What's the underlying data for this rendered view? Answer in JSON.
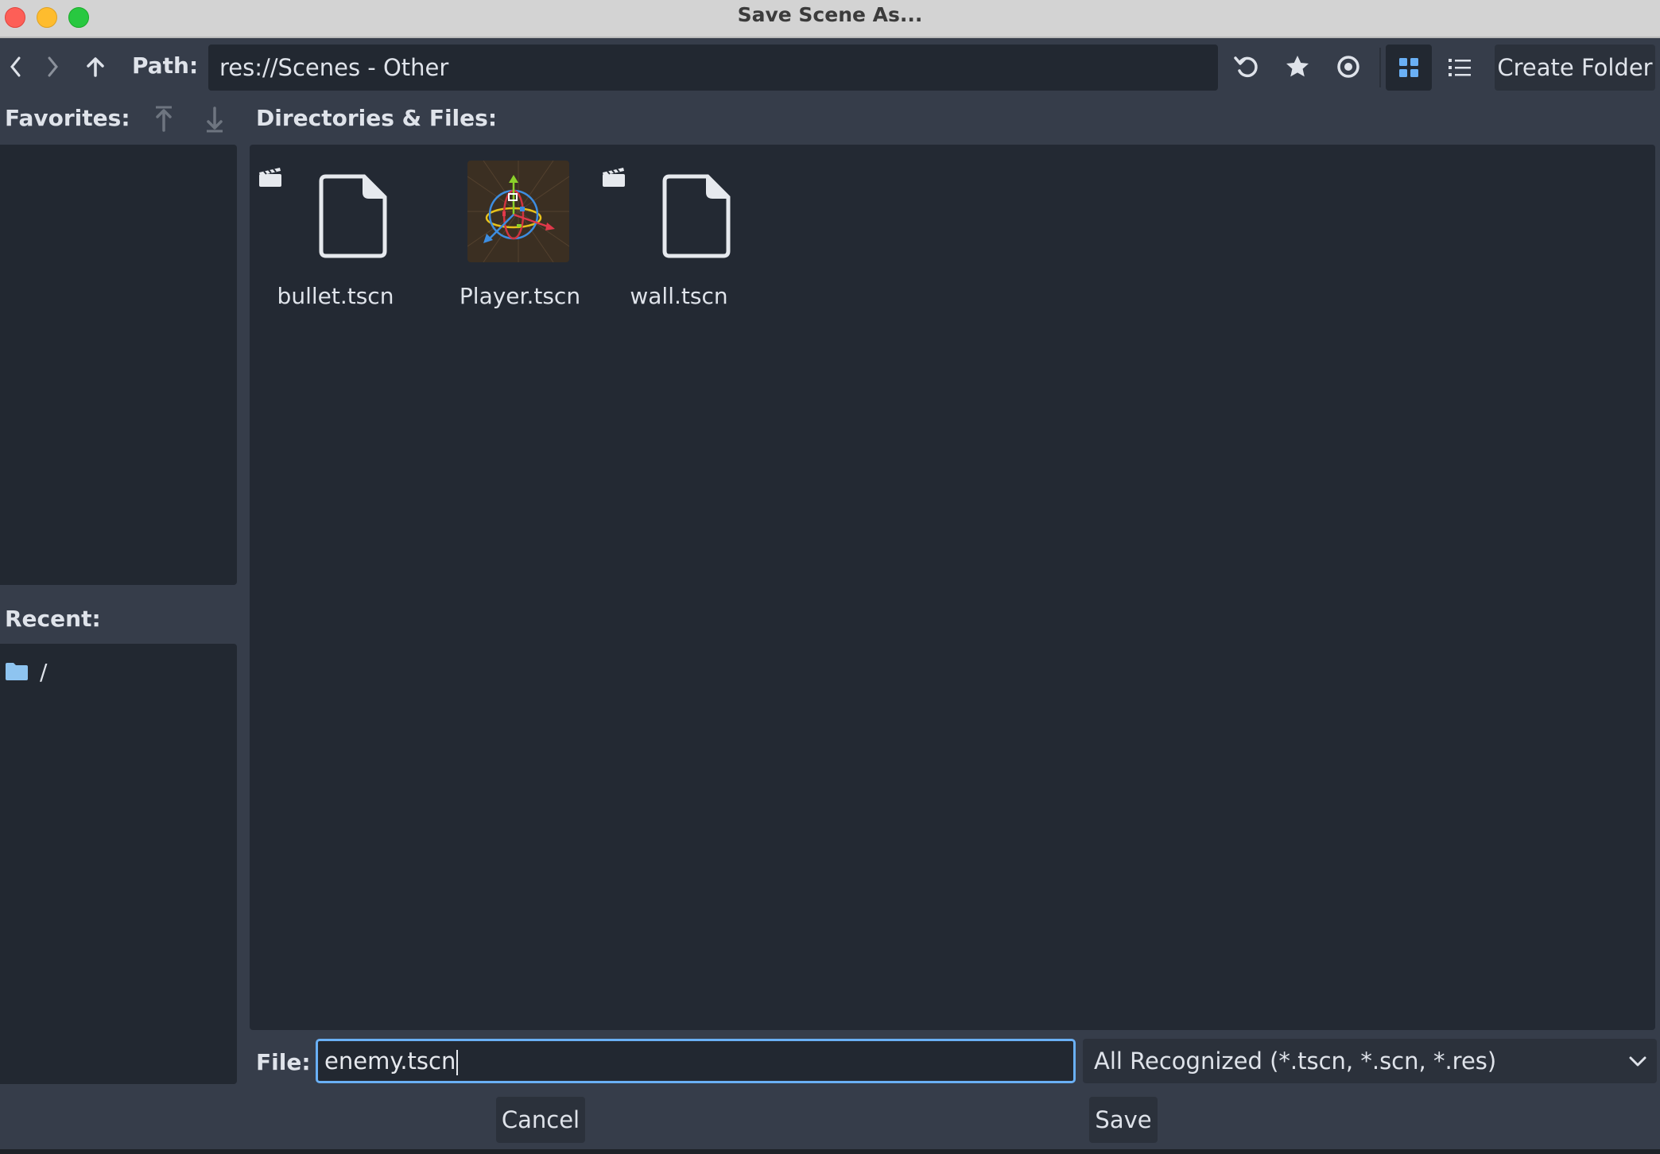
{
  "window": {
    "title": "Save Scene As..."
  },
  "toolbar": {
    "path_label": "Path:",
    "path_value": "res://Scenes - Other",
    "create_folder_label": "Create Folder"
  },
  "favorites": {
    "label": "Favorites:"
  },
  "recent": {
    "label": "Recent:",
    "items": [
      {
        "label": "/"
      }
    ]
  },
  "files": {
    "label": "Directories & Files:",
    "items": [
      {
        "name": "bullet.tscn"
      },
      {
        "name": "Player.tscn"
      },
      {
        "name": "wall.tscn"
      }
    ]
  },
  "footer": {
    "file_label": "File:",
    "file_value": "enemy.tscn",
    "filter_value": "All Recognized (*.tscn, *.scn, *.res)",
    "cancel_label": "Cancel",
    "save_label": "Save"
  },
  "colors": {
    "accent": "#6ab0f5",
    "background": "#363d4a",
    "panel": "#222831",
    "folder_icon": "#8ec4f0"
  },
  "icons": [
    "back-icon",
    "forward-icon",
    "up-icon",
    "refresh-icon",
    "star-icon",
    "eye-icon",
    "grid-view-icon",
    "list-view-icon",
    "move-up-icon",
    "move-down-icon",
    "folder-icon",
    "file-icon",
    "scene-icon",
    "chevron-down-icon"
  ]
}
